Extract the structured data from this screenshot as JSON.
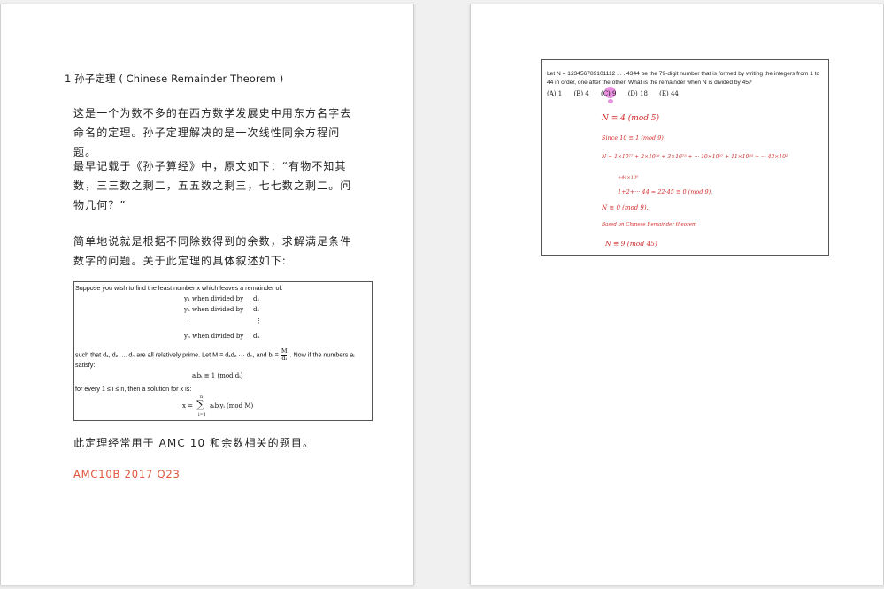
{
  "left_page": {
    "heading": "1 孙子定理 ( Chinese Remainder Theorem )",
    "para1": "这是一个为数不多的在西方数学发展史中用东方名字去命名的定理。孙子定理解决的是一次线性同余方程问题。",
    "para2": "最早记载于《孙子算经》中，原文如下：“有物不知其数，三三数之剩二，五五数之剩三，七七数之剩二。问物几何？”",
    "para3": "简单地说就是根据不同除数得到的余数，求解满足条件数字的问题。关于此定理的具体叙述如下:",
    "theorem": {
      "intro": "Suppose you wish to find the least number x which leaves a remainder of:",
      "rows": [
        {
          "y": "y₁ when divided by",
          "d": "d₁"
        },
        {
          "y": "y₂ when divided by",
          "d": "d₂"
        },
        {
          "y": "⋮",
          "d": "⋮"
        },
        {
          "y": "yₙ when divided by",
          "d": "dₙ"
        }
      ],
      "such_that_a": "such that d₁, d₂, ... dₙ are all relatively prime. Let M = d₁d₂ ··· dₙ, and bᵢ =",
      "frac_num": "M",
      "frac_den": "dᵢ",
      "such_that_b": ". Now if the numbers aᵢ",
      "satisfy": "satisfy:",
      "eq1": "aᵢbᵢ ≡ 1 (mod dᵢ)",
      "for_every": "for every 1 ≤ i ≤ n, then a solution for x is:",
      "sum_top": "n",
      "sum_lhs": "x =",
      "sum_sigma": "∑",
      "sum_rhs": "aᵢbᵢyᵢ (mod M)",
      "sum_bottom": "i=1"
    },
    "para4": "此定理经常用于 AMC 10 和余数相关的题目。",
    "link_text": "AMC10B 2017 Q23"
  },
  "right_page": {
    "problem_text": "Let N = 123456789101112 . . . 4344 be the 79-digit number that is formed by writing the integers from 1 to 44 in order, one after the other. What is the remainder when N is divided by 45?",
    "choices": [
      "(A) 1",
      "(B) 4",
      "(C) 9",
      "(D) 18",
      "(E) 44"
    ],
    "handwriting": {
      "line1": "N ≡ 4 (mod 5)",
      "line2": "Since 10 ≡ 1 (mod 9)",
      "line3": "N = 1×10⁷⁷ + 2×10⁷⁶ + 3×10⁷⁵ + ··· 10×10⁶⁷ + 11×10⁶⁵ + ··· 43×10²",
      "line4": "+44×10⁰",
      "line5": "1+2+··· 44 = 22·45 ≡ 0 (mod 9).",
      "line6": "N ≡ 0 (mod 9).",
      "line7": "Based on Chinese Remainder theorem",
      "line8": "N ≡ 9 (mod 45)"
    },
    "colors": {
      "ink": "#d22a2a",
      "highlight": "#e36bd6"
    }
  }
}
